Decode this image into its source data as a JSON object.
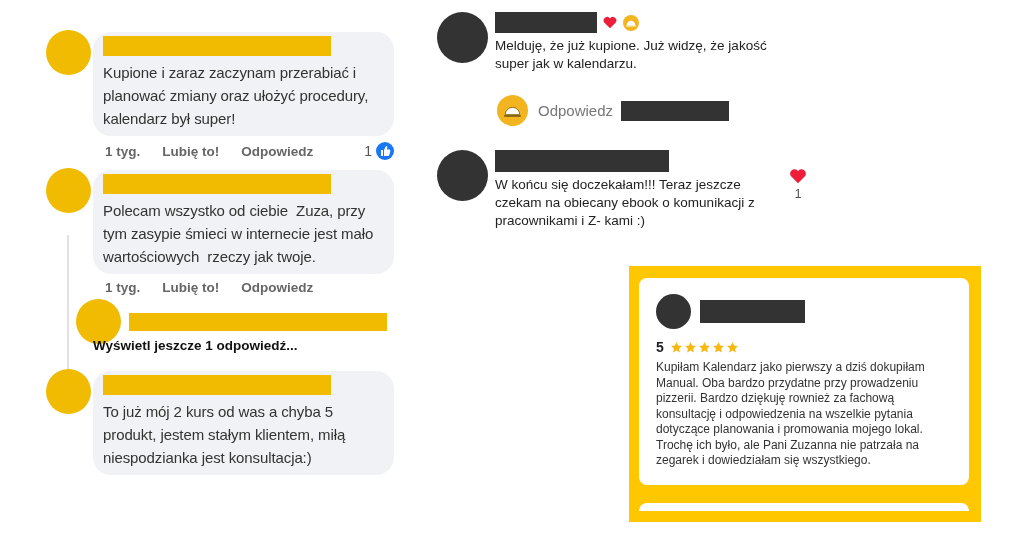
{
  "left_thread": {
    "items": [
      {
        "kind": "comment",
        "text": "Kupione i zaraz zaczynam przerabiać i planować zmiany oraz ułożyć procedury, kalendarz był super!",
        "time": "1 tyg.",
        "like_label": "Lubię to!",
        "reply_label": "Odpowiedz",
        "reaction_count": "1"
      },
      {
        "kind": "comment",
        "text": "Polecam wszystko od ciebie  Zuza, przy tym zasypie śmieci w internecie jest mało wartościowych  rzeczy jak twoje.",
        "time": "1 tyg.",
        "like_label": "Lubię to!",
        "reply_label": "Odpowiedz"
      },
      {
        "kind": "reply_preview"
      },
      {
        "kind": "more_replies",
        "text": "Wyświetl jeszcze 1 odpowiedź..."
      },
      {
        "kind": "comment",
        "text": "To już mój 2 kurs od was a chyba 5 produkt, jestem stałym klientem, miłą niespodzianka jest konsultacja:)"
      }
    ]
  },
  "right_thread": {
    "items": [
      {
        "kind": "comment",
        "text": "Melduję, że już kupione. Już widzę, że jakość super jak w kalendarzu.",
        "liked_by_author": true
      },
      {
        "kind": "reply",
        "reply_label": "Odpowiedz"
      },
      {
        "kind": "comment",
        "text": "W końcu się doczekałam!!! Teraz jeszcze czekam na obiecany ebook o komunikacji z pracownikami i Z- kami :)",
        "heart_count": "1"
      }
    ]
  },
  "review": {
    "rating": "5",
    "stars": 5,
    "text": "Kupiłam Kalendarz jako pierwszy a dziś dokupiłam Manual. Oba bardzo przydatne przy prowadzeniu pizzerii. Bardzo dziękuję rownież za fachową konsultację i odpowiedzenia na wszelkie pytania dotyczące planowania i promowania mojego lokal. Trochę ich było, ale Pani Zuzanna nie patrzała na zegarek i dowiedziałam się wszystkiego."
  }
}
